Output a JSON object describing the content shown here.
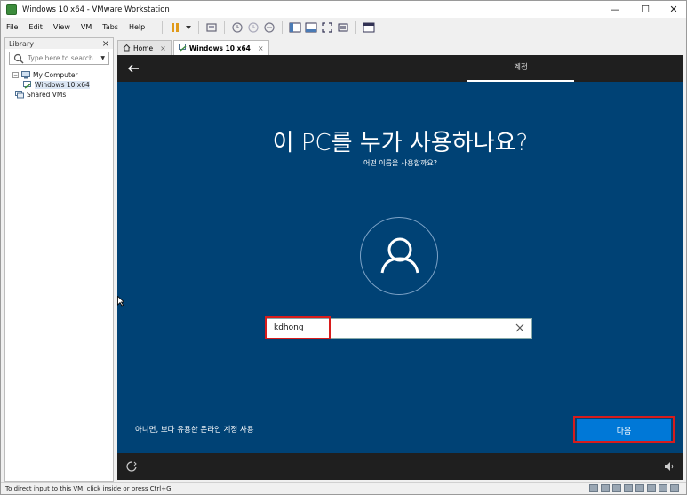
{
  "window": {
    "title": "Windows 10 x64 - VMware Workstation",
    "minimize": "—",
    "maximize": "☐",
    "close": "✕"
  },
  "menu": [
    "File",
    "Edit",
    "View",
    "VM",
    "Tabs",
    "Help"
  ],
  "library": {
    "header": "Library",
    "close": "×",
    "search_placeholder": "Type here to search",
    "tree": {
      "root": "My Computer",
      "vm": "Windows 10 x64",
      "shared": "Shared VMs"
    }
  },
  "tabs": [
    {
      "label": "Home",
      "close": "×"
    },
    {
      "label": "Windows 10 x64",
      "close": "×"
    }
  ],
  "vm_screen": {
    "top_tab": "계정",
    "heading": "이 PC를 누가 사용하나요?",
    "subheading": "어떤 이름을 사용할까요?",
    "name_value": "kdhong",
    "online_link": "아니면, 보다 유용한 온라인 계정 사용",
    "next_button": "다음"
  },
  "status": {
    "message": "To direct input to this VM, click inside or press Ctrl+G."
  },
  "colors": {
    "oobe_blue": "#004275",
    "next_blue": "#0078d7",
    "highlight_red": "#d81c1c",
    "bar_dark": "#1f1f1f"
  }
}
